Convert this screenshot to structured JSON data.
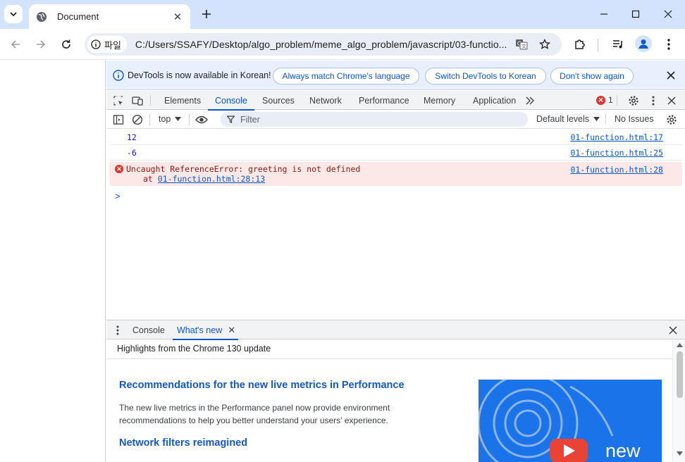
{
  "browser": {
    "tab_title": "Document",
    "chip_label": "파일",
    "url": "C:/Users/SSAFY/Desktop/algo_problem/meme_algo_problem/javascript/03-functio..."
  },
  "infobar": {
    "text": "DevTools is now available in Korean!",
    "btn_match": "Always match Chrome's language",
    "btn_switch": "Switch DevTools to Korean",
    "btn_dont_show": "Don't show again"
  },
  "devtools_tabs": {
    "elements": "Elements",
    "console": "Console",
    "sources": "Sources",
    "network": "Network",
    "performance": "Performance",
    "memory": "Memory",
    "application": "Application",
    "error_count": "1"
  },
  "console_toolbar": {
    "context": "top",
    "filter_placeholder": "Filter",
    "levels": "Default levels",
    "issues": "No Issues"
  },
  "console_messages": [
    {
      "value": "12",
      "source": "01-function.html:17"
    },
    {
      "value": "-6",
      "source": "01-function.html:25"
    }
  ],
  "error_message": {
    "line1": "Uncaught ReferenceError: greeting is not defined",
    "at_prefix": "at",
    "at_link": "01-function.html:28:13",
    "source": "01-function.html:28"
  },
  "prompt_symbol": ">",
  "drawer": {
    "tab_console": "Console",
    "tab_whats_new": "What's new",
    "highlights": "Highlights from the Chrome 130 update",
    "heading1": "Recommendations for the new live metrics in Performance",
    "paragraph1": "The new live metrics in the Performance panel now provide environment recommendations to help you better understand your users' experience.",
    "heading2": "Network filters reimagined",
    "image_text": "new"
  },
  "colors": {
    "accent": "#0b57d0",
    "error": "#dc362e",
    "tabstrip": "#d3e3fd"
  }
}
